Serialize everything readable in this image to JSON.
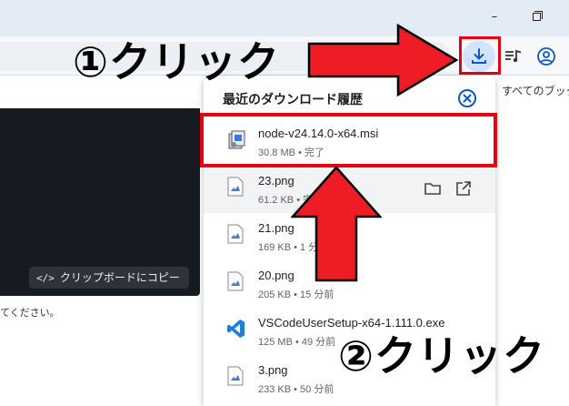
{
  "window": {
    "minimize_glyph": "–",
    "maximize_icon": "restore-icon"
  },
  "toolbar": {
    "extension_icon": "puzzle-icon",
    "download_icon": "download-icon",
    "media_icon": "media-queue-icon",
    "profile_icon": "profile-icon",
    "accent_color": "#0b57d0",
    "download_active_bg": "#d3e3fd"
  },
  "bookmarks": {
    "all_bookmarks": "すべてのブックマ"
  },
  "page": {
    "copy_icon": "</>",
    "copy_label": "クリップボードにコピー",
    "text_fragment": "てください。"
  },
  "downloads_panel": {
    "title": "最近のダウンロード履歴",
    "close_icon": "close-circle-icon",
    "items": [
      {
        "name": "node-v24.14.0-x64.msi",
        "meta": "30.8 MB • 完了",
        "icon": "msi-installer-icon"
      },
      {
        "name": "23.png",
        "meta": "61.2 KB • 完了",
        "icon": "image-file-icon"
      },
      {
        "name": "21.png",
        "meta": "169 KB • 1 分前",
        "icon": "image-file-icon"
      },
      {
        "name": "20.png",
        "meta": "205 KB • 15 分前",
        "icon": "image-file-icon"
      },
      {
        "name": "VSCodeUserSetup-x64-1.111.0.exe",
        "meta": "125 MB • 49 分前",
        "icon": "vscode-icon"
      },
      {
        "name": "3.png",
        "meta": "233 KB • 50 分前",
        "icon": "image-file-icon"
      }
    ],
    "row_actions": {
      "show_in_folder_icon": "folder-icon",
      "open_icon": "open-external-icon"
    }
  },
  "annotations": {
    "step1": "①クリック",
    "step2": "②クリック",
    "highlight_color": "#e60012",
    "arrow_fill": "#ee1c25"
  }
}
